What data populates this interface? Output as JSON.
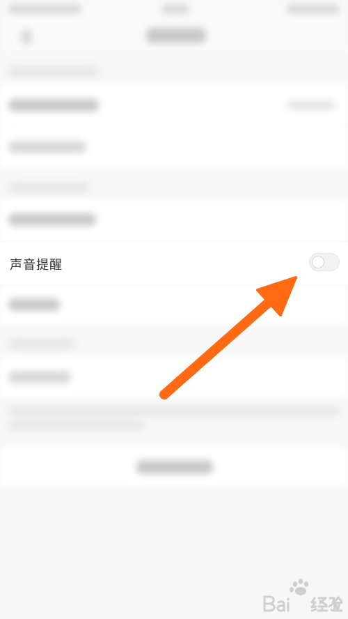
{
  "settings": {
    "sound_reminder_label": "声音提醒",
    "sound_reminder_enabled": false
  },
  "annotation": {
    "arrow_color": "#ff6a13"
  },
  "watermark": {
    "text": "Baidu经验"
  }
}
